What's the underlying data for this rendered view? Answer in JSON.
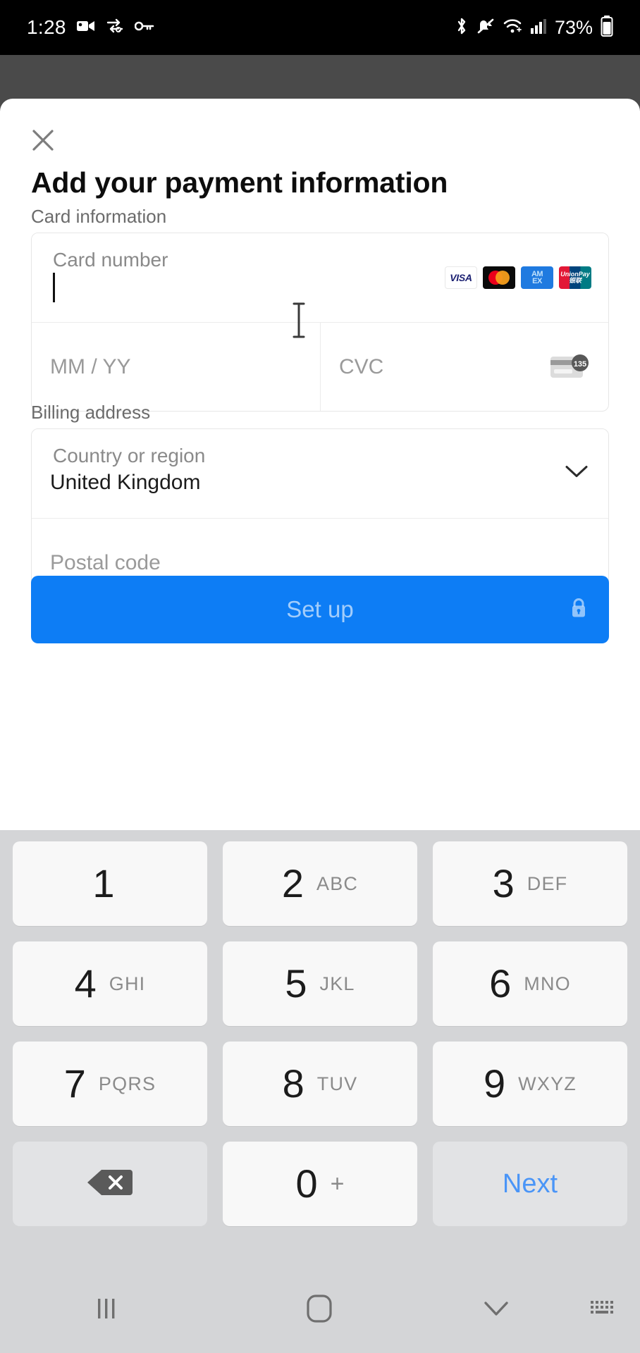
{
  "status_bar": {
    "time": "1:28",
    "battery_percent": "73%",
    "left_icons": [
      "video-camera-icon",
      "vpn-key-exchange-icon",
      "key-icon"
    ],
    "right_icons": [
      "bluetooth-icon",
      "mute-bell-icon",
      "wifi-icon",
      "cellular-signal-icon",
      "battery-icon"
    ]
  },
  "sheet": {
    "close_label": "✕",
    "title": "Add your payment information",
    "card_section_label": "Card information",
    "card_number": {
      "label": "Card number",
      "value": "",
      "placeholder": ""
    },
    "expiry": {
      "placeholder": "MM / YY",
      "value": ""
    },
    "cvc": {
      "placeholder": "CVC",
      "value": "",
      "hint_icon_digits": "135"
    },
    "accepted_brands": [
      {
        "name": "visa",
        "label": "VISA"
      },
      {
        "name": "mastercard",
        "label": ""
      },
      {
        "name": "amex",
        "label_top": "AM",
        "label_bottom": "EX"
      },
      {
        "name": "unionpay",
        "label_top": "UnionPay",
        "label_bottom": "银联"
      }
    ],
    "billing_section_label": "Billing address",
    "country": {
      "label": "Country or region",
      "value": "United Kingdom"
    },
    "postal_code": {
      "placeholder": "Postal code",
      "value": ""
    },
    "submit": {
      "label": "Set up",
      "color": "#0d7df5",
      "disabled_text_color": "rgba(255,255,255,0.62)",
      "lock_icon": "lock-icon"
    }
  },
  "keypad": {
    "rows": [
      [
        {
          "digit": "1",
          "letters": ""
        },
        {
          "digit": "2",
          "letters": "ABC"
        },
        {
          "digit": "3",
          "letters": "DEF"
        }
      ],
      [
        {
          "digit": "4",
          "letters": "GHI"
        },
        {
          "digit": "5",
          "letters": "JKL"
        },
        {
          "digit": "6",
          "letters": "MNO"
        }
      ],
      [
        {
          "digit": "7",
          "letters": "PQRS"
        },
        {
          "digit": "8",
          "letters": "TUV"
        },
        {
          "digit": "9",
          "letters": "WXYZ"
        }
      ]
    ],
    "bottom": {
      "backspace_icon": "backspace-icon",
      "zero": "0",
      "plus": "+",
      "next_label": "Next",
      "next_color": "#4a95f7"
    }
  },
  "navbar": {
    "recents_icon": "recents-icon",
    "home_icon": "home-icon",
    "back_icon": "chevron-down-icon",
    "keyboard_icon": "keyboard-switch-icon"
  }
}
